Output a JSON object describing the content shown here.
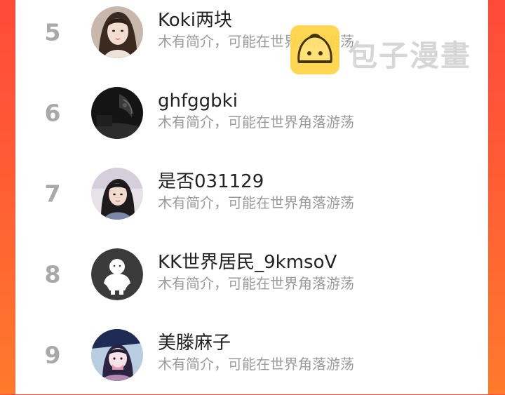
{
  "watermark": {
    "text": "包子漫畫",
    "logo": "baozi-logo-icon",
    "logo_color": "#ffd54a"
  },
  "colors": {
    "background_accent": "#ff5a35",
    "rank_color": "#a9a9a9",
    "name_color": "#222222",
    "bio_color": "#9a9a9a"
  },
  "users": [
    {
      "rank": "5",
      "name": "Koki两块",
      "bio": "木有简介，可能在世界角落游荡",
      "avatar": "user-photo-avatar"
    },
    {
      "rank": "6",
      "name": "ghfggbki",
      "bio": "木有简介，可能在世界角落游荡",
      "avatar": "dark-photo-avatar"
    },
    {
      "rank": "7",
      "name": "是否031129",
      "bio": "木有简介，可能在世界角落游荡",
      "avatar": "user-photo-avatar"
    },
    {
      "rank": "8",
      "name": "KK世界居民_9kmsoV",
      "bio": "木有简介，可能在世界角落游荡",
      "avatar": "default-avatar-icon"
    },
    {
      "rank": "9",
      "name": "美滕麻子",
      "bio": "木有简介，可能在世界角落游荡",
      "avatar": "cartoon-avatar"
    }
  ]
}
